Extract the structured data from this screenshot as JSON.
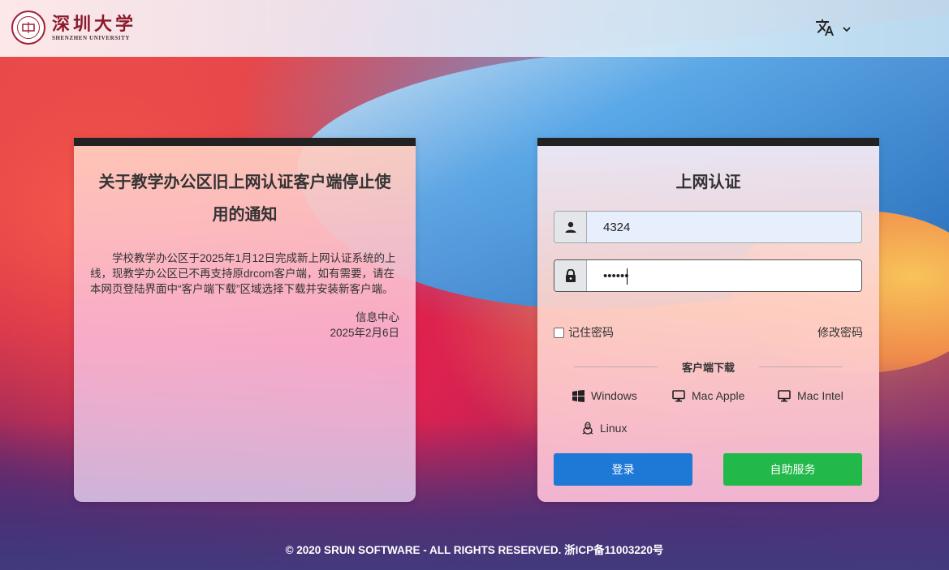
{
  "header": {
    "logo_cn": "深圳大学",
    "logo_en": "SHENZHEN UNIVERSITY",
    "language_icon": "translate-icon"
  },
  "notice": {
    "title": "关于教学办公区旧上网认证客户端停止使用的通知",
    "body": "学校教学办公区于2025年1月12日完成新上网认证系统的上线，现教学办公区已不再支持原drcom客户端，如有需要，请在本网页登陆界面中“客户端下载”区域选择下载并安装新客户端。",
    "sign_org": "信息中心",
    "sign_date": "2025年2月6日"
  },
  "login": {
    "title": "上网认证",
    "username_value": "4324",
    "password_value": "••••••",
    "remember_label": "记住密码",
    "change_password_label": "修改密码",
    "download_title": "客户端下载",
    "downloads": [
      {
        "label": "Windows",
        "icon": "windows-icon"
      },
      {
        "label": "Mac Apple",
        "icon": "monitor-icon"
      },
      {
        "label": "Mac Intel",
        "icon": "monitor-icon"
      },
      {
        "label": "Linux",
        "icon": "linux-icon"
      }
    ],
    "login_button": "登录",
    "self_service_button": "自助服务"
  },
  "footer": {
    "text": "© 2020 SRUN SOFTWARE - ALL RIGHTS RESERVED. 浙ICP备11003220号"
  }
}
